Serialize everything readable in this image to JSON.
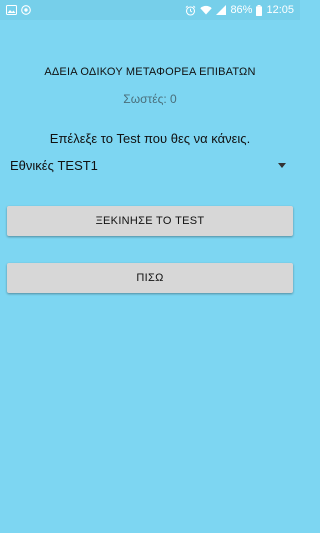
{
  "status_bar": {
    "battery": "86%",
    "time": "12:05",
    "icons": [
      "image-icon",
      "app-notification-icon",
      "alarm-icon",
      "wifi-icon",
      "signal-icon",
      "battery-icon"
    ]
  },
  "screen": {
    "title": "ΑΔΕΙΑ ΟΔΙΚΟΥ ΜΕΤΑΦΟΡΕΑ ΕΠΙΒΑΤΩΝ",
    "score_label": "Σωστές:",
    "score_value": "0",
    "prompt": "Επέλεξε το Test που θες να κάνεις.",
    "test_select": {
      "selected": "Εθνικές TEST1"
    },
    "start_button": "ΞΕΚΙΝΗΣΕ ΤΟ TEST",
    "back_button": "ΠΙΣΩ"
  },
  "colors": {
    "background": "#7dd6f2",
    "button": "#d7d7d7",
    "text": "#111111"
  }
}
